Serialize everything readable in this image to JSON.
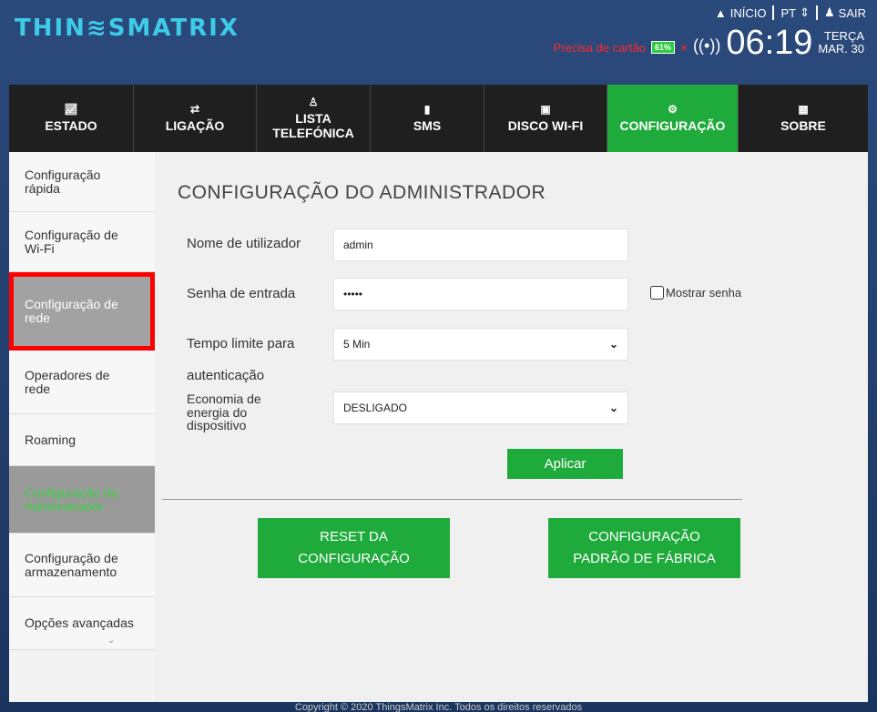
{
  "header": {
    "logo": "THIN≋SMATRIX",
    "links": {
      "home": "INÍCIO",
      "lang": "PT",
      "logout": "SAIR"
    },
    "status": {
      "card_warning": "Precisa de cartão",
      "battery": "61%",
      "time": "06:19",
      "day": "TERÇA",
      "date": "MAR. 30"
    }
  },
  "nav": {
    "items": [
      {
        "label": "ESTADO",
        "icon": "chart-icon"
      },
      {
        "label": "LIGAÇÃO",
        "icon": "transfer-icon"
      },
      {
        "label": "LISTA TELEFÓNICA",
        "icon": "contact-icon"
      },
      {
        "label": "SMS",
        "icon": "message-icon"
      },
      {
        "label": "DISCO WI-FI",
        "icon": "disk-icon"
      },
      {
        "label": "CONFIGURAÇÃO",
        "icon": "gears-icon"
      },
      {
        "label": "SOBRE",
        "icon": "info-icon"
      }
    ],
    "active": "CONFIGURAÇÃO"
  },
  "sidebar": {
    "items": [
      {
        "label": "Configuração rápida"
      },
      {
        "label": "Configuração de Wi-Fi"
      },
      {
        "label": "Configuração de rede"
      },
      {
        "label": "Operadores de rede"
      },
      {
        "label": "Roaming"
      },
      {
        "label": "Configuração do Administrador"
      },
      {
        "label": "Configuração de armazenamento"
      },
      {
        "label": "Opções avançadas"
      }
    ]
  },
  "main": {
    "title": "CONFIGURAÇÃO DO ADMINISTRADOR",
    "username_label": "Nome de utilizador",
    "username_value": "admin",
    "password_label": "Senha de entrada",
    "password_value": "•••••",
    "show_password": "Mostrar senha",
    "timeout_label_1": "Tempo limite para",
    "timeout_label_2": "autenticação",
    "timeout_value": "5 Min",
    "power_label": "Economia de energia do dispositivo",
    "power_value": "DESLIGADO",
    "apply": "Aplicar",
    "reset_line1": "RESET DA",
    "reset_line2": "CONFIGURAÇÃO",
    "factory_line1": "CONFIGURAÇÃO",
    "factory_line2": "PADRÃO DE FÁBRICA"
  },
  "footer": "Copyright © 2020 ThingsMatrix Inc. Todos os direitos reservados"
}
